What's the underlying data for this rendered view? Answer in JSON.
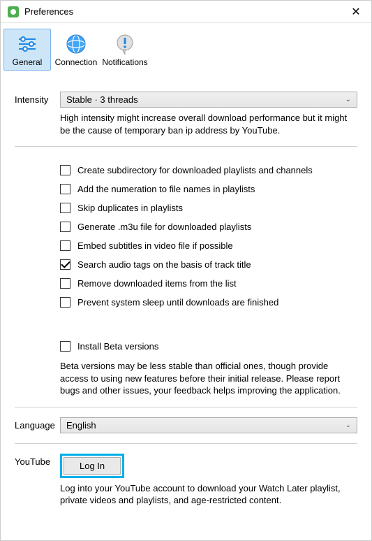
{
  "window": {
    "title": "Preferences"
  },
  "tabs": {
    "general": "General",
    "connection": "Connection",
    "notifications": "Notifications"
  },
  "intensity": {
    "label": "Intensity",
    "value": "Stable · 3 threads",
    "help": "High intensity might increase overall download performance but it might be the cause of temporary ban ip address by YouTube."
  },
  "options": {
    "create_subdir": "Create subdirectory for downloaded playlists and channels",
    "add_numeration": "Add the numeration to file names in playlists",
    "skip_duplicates": "Skip duplicates in playlists",
    "generate_m3u": "Generate .m3u file for downloaded playlists",
    "embed_subtitles": "Embed subtitles in video file if possible",
    "search_audio_tags": "Search audio tags on the basis of track title",
    "remove_downloaded": "Remove downloaded items from the list",
    "prevent_sleep": "Prevent system sleep until downloads are finished"
  },
  "options_checked": {
    "search_audio_tags": true
  },
  "beta": {
    "label": "Install Beta versions",
    "help": "Beta versions may be less stable than official ones, though provide access to using new features before their initial release. Please report bugs and other issues, your feedback helps improving the application."
  },
  "language": {
    "label": "Language",
    "value": "English"
  },
  "youtube": {
    "label": "YouTube",
    "button": "Log In",
    "help": "Log into your YouTube account to download your Watch Later playlist, private videos and playlists, and age-restricted content."
  }
}
